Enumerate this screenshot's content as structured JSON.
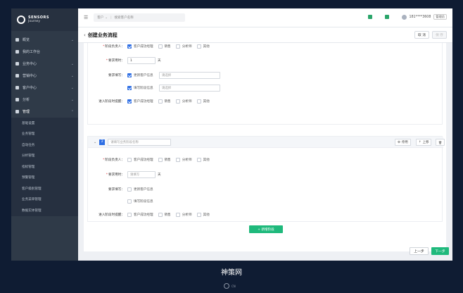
{
  "app": {
    "logo_line1": "SENSORS",
    "logo_line2": "Journey"
  },
  "sidebar": {
    "items": [
      {
        "label": "概览",
        "chevron": "⌄"
      },
      {
        "label": "我的工作台",
        "chevron": ""
      },
      {
        "label": "业务中心",
        "chevron": "⌄"
      },
      {
        "label": "营销中心",
        "chevron": "⌄"
      },
      {
        "label": "客户中心",
        "chevron": "⌄"
      },
      {
        "label": "分析",
        "chevron": "⌄"
      },
      {
        "label": "管理",
        "chevron": "⌃"
      }
    ],
    "sub_items": [
      "基础设置",
      "业务管理",
      "自动任务",
      "分析管理",
      "指标管理",
      "预警管理",
      "客户级别管理",
      "业务菜单管理",
      "数据实体管理"
    ]
  },
  "topbar": {
    "menu_icon": "☰",
    "search_scope": "客户",
    "search_caret": "⌄",
    "search_placeholder": "搜索客户名称",
    "phone": "181****3608",
    "role": "管理员"
  },
  "header": {
    "back": "‹",
    "title": "创建业务流程",
    "cancel": "取 消",
    "save": "保 存"
  },
  "stage1": {
    "owner_label": "阶段负责人：",
    "owner_options": [
      "客户成功经理",
      "销售",
      "分析师",
      "其他"
    ],
    "time_label": "要求用时：",
    "time_value": "1",
    "time_unit": "天",
    "fill_label": "要求填写：",
    "fill_options": [
      "更新客户信息",
      "填写阶段信息"
    ],
    "fill_placeholder": "请选择",
    "remind_label": "进入阶段时提醒：",
    "remind_options": [
      "客户成功经理",
      "销售",
      "分析师",
      "其他"
    ]
  },
  "stage2": {
    "number": "2",
    "name_placeholder": "请填写业务阶段名称",
    "stop": "停用",
    "up": "上移",
    "stop_icon": "⚙",
    "up_icon": "⇡",
    "delete_icon": "🗑",
    "owner_label": "阶段负责人：",
    "owner_options": [
      "客户成功经理",
      "销售",
      "分析师",
      "其他"
    ],
    "time_label": "要求用时：",
    "time_placeholder": "请填写",
    "time_unit": "天",
    "fill_label": "要求填写：",
    "fill_options": [
      "更新客户信息",
      "填写阶段信息"
    ],
    "remind_label": "进入阶段时提醒：",
    "remind_options": [
      "客户成功经理",
      "销售",
      "分析师",
      "其他"
    ],
    "collapse_icon": "⌄"
  },
  "actions": {
    "add_stage": "+ 新增阶段",
    "prev": "上一步",
    "next": "下一步"
  },
  "watermark": {
    "text": "神策网",
    "sub": "CN"
  },
  "colors": {
    "accent": "#2f6fe4",
    "primary_green": "#1fb97c",
    "sidebar": "#2f3a48"
  }
}
